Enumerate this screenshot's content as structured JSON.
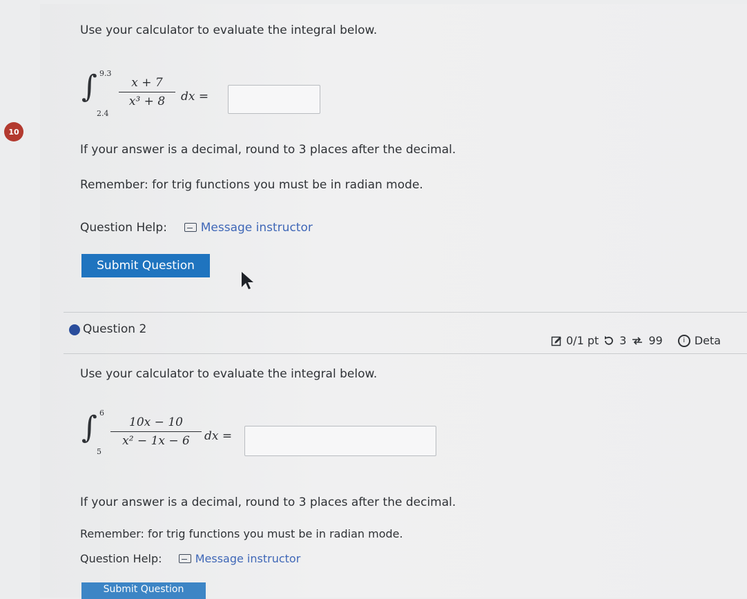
{
  "q1": {
    "prompt": "Use your calculator to evaluate the integral below.",
    "upper": "9.3",
    "lower": "2.4",
    "numerator": "x + 7",
    "denominator": "x³ + 8",
    "dx": "dx =",
    "badge": "10",
    "round_note": "If your answer is a decimal, round to 3 places after the decimal.",
    "trig_note": "Remember: for trig functions you must be in radian mode.",
    "help_label": "Question Help:",
    "help_link": "Message instructor",
    "submit_label": "Submit Question"
  },
  "q2": {
    "title": "Question 2",
    "status": {
      "points": "0/1 pt",
      "retries": "3",
      "attempts": "99",
      "details": "Deta"
    },
    "prompt": "Use your calculator to evaluate the integral below.",
    "upper": "6",
    "lower": "5",
    "numerator": "10x − 10",
    "denominator": "x² − 1x − 6",
    "dx": "dx =",
    "round_note": "If your answer is a decimal, round to 3 places after the decimal.",
    "trig_note": "Remember: for trig functions you must be in radian mode.",
    "help_label": "Question Help:",
    "help_link": "Message instructor",
    "submit_label": "Submit Question"
  },
  "icons": {
    "badge_color": "#b33a2f",
    "button_color": "#1f74bf",
    "link_color": "#3f67b7",
    "dot_color": "#2a4d9c"
  }
}
